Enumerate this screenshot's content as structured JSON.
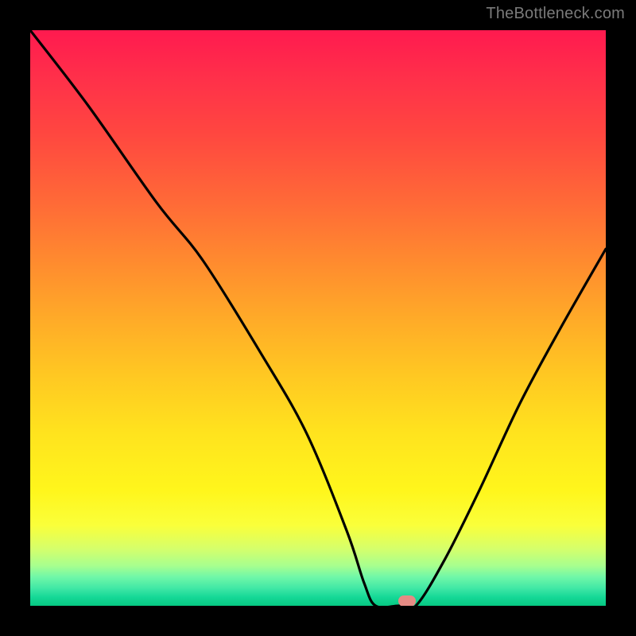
{
  "watermark": "TheBottleneck.com",
  "chart_data": {
    "type": "line",
    "title": "",
    "xlabel": "",
    "ylabel": "",
    "xlim": [
      0,
      100
    ],
    "ylim": [
      0,
      100
    ],
    "grid": false,
    "legend": false,
    "series": [
      {
        "name": "bottleneck-curve",
        "x": [
          0,
          10,
          22,
          30,
          40,
          48,
          55,
          58,
          60,
          64,
          67,
          72,
          78,
          85,
          92,
          100
        ],
        "y": [
          100,
          87,
          70,
          60,
          44,
          30,
          13,
          4,
          0,
          0,
          0,
          8,
          20,
          35,
          48,
          62
        ]
      }
    ],
    "marker": {
      "x": 65.5,
      "y": 0.8
    },
    "gradient_stops": [
      {
        "pct": 0,
        "color": "#ff1a4f"
      },
      {
        "pct": 50,
        "color": "#ffaa28"
      },
      {
        "pct": 80,
        "color": "#fff61c"
      },
      {
        "pct": 97,
        "color": "#3fe7a5"
      },
      {
        "pct": 100,
        "color": "#06c982"
      }
    ]
  }
}
